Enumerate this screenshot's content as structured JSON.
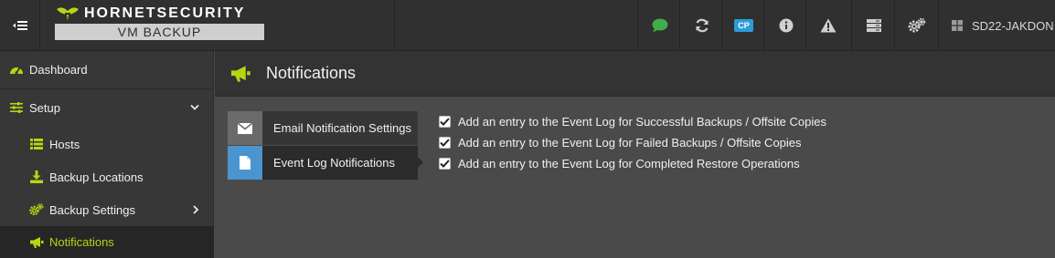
{
  "topbar": {
    "brand": "HORNETSECURITY",
    "product": "VM BACKUP",
    "cp_badge": "CP",
    "hostname": "SD22-JAKDON",
    "icons": [
      "menu-collapse-icon",
      "chat-icon",
      "refresh-icon",
      "cp-icon",
      "info-icon",
      "warning-icon",
      "server-icon",
      "settings-icon",
      "windows-icon"
    ]
  },
  "sidebar": {
    "items": [
      {
        "label": "Dashboard",
        "icon": "dashboard-icon"
      },
      {
        "label": "Setup",
        "icon": "sliders-icon"
      },
      {
        "label": "Hosts",
        "icon": "list-icon"
      },
      {
        "label": "Backup Locations",
        "icon": "download-icon"
      },
      {
        "label": "Backup Settings",
        "icon": "cogs-icon"
      },
      {
        "label": "Notifications",
        "icon": "megaphone-icon",
        "active": true
      }
    ]
  },
  "page": {
    "title": "Notifications"
  },
  "tabs": [
    {
      "label": "Email Notification Settings",
      "icon": "envelope-icon"
    },
    {
      "label": "Event Log Notifications",
      "icon": "document-icon",
      "active": true
    }
  ],
  "options": [
    {
      "label": "Add an entry to the Event Log for Successful Backups / Offsite Copies",
      "checked": true
    },
    {
      "label": "Add an entry to the Event Log for Failed Backups / Offsite Copies",
      "checked": true
    },
    {
      "label": "Add an entry to the Event Log for Completed Restore Operations",
      "checked": true
    }
  ],
  "colors": {
    "accent": "#b4d613",
    "topbar": "#303030",
    "sidebar": "#373737",
    "content": "#4a4a4a",
    "active_tab_icon": "#4a94cf",
    "cp_badge": "#2d9cd8",
    "chat_icon": "#3fae49"
  }
}
